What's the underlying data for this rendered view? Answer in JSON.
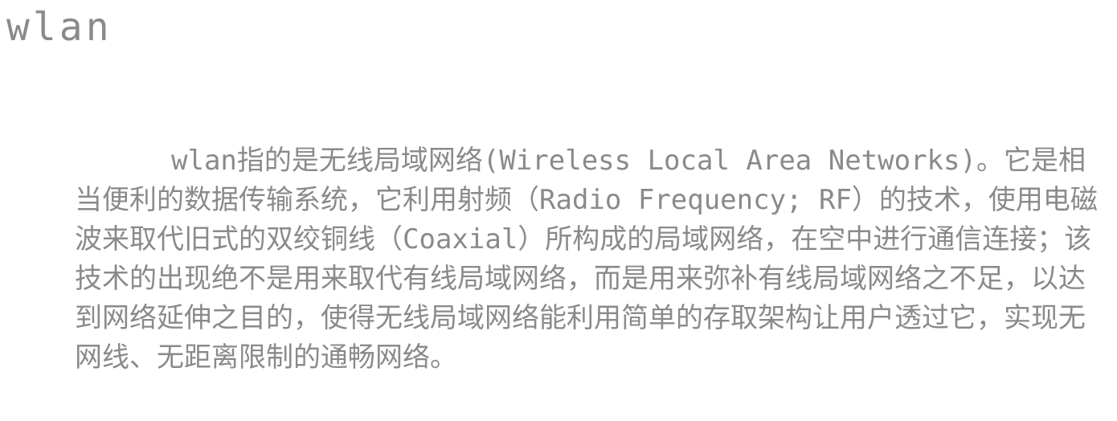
{
  "slide": {
    "title": "wlan",
    "paragraph": "wlan指的是无线局域网络(Wireless Local Area Networks)。它是相当便利的数据传输系统，它利用射频（Radio Frequency; RF）的技术，使用电磁波来取代旧式的双绞铜线（Coaxial）所构成的局域网络，在空中进行通信连接；该技术的出现绝不是用来取代有线局域网络，而是用来弥补有线局域网络之不足，以达到网络延伸之目的，使得无线局域网络能利用简单的存取架构让用户透过它，实现无网线、无距离限制的通畅网络。"
  }
}
